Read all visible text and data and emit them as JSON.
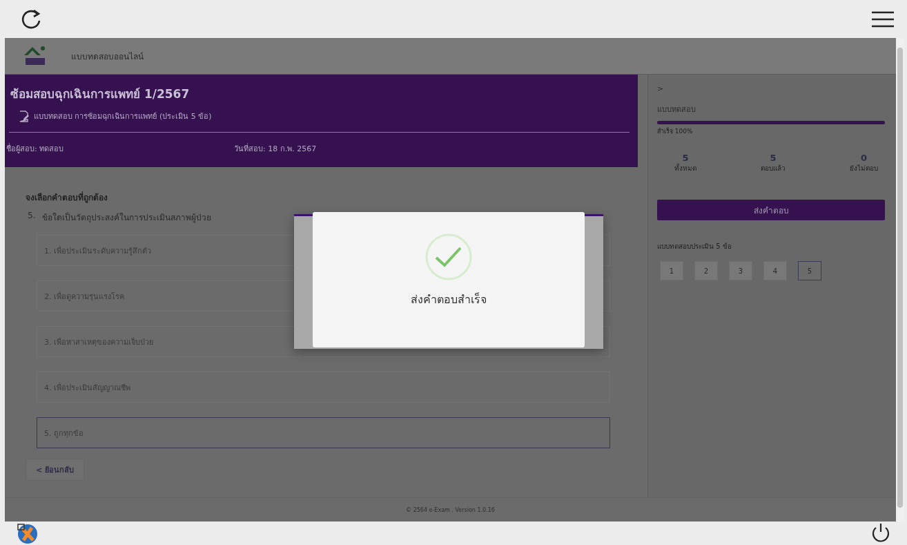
{
  "app_header": {
    "title": "แบบทดสอบออนไลน์"
  },
  "exam_header": {
    "title": "ซ้อมสอบฉุกเฉินการแพทย์ 1/2567",
    "subtitle": "แบบทดสอบ การซ้อมฉุกเฉินการแพทย์ (ประเมิน 5 ข้อ)",
    "examinee": "ชื่อผู้สอบ: ทดสอบ",
    "date": "วันที่สอบ: 18 ก.พ. 2567"
  },
  "question": {
    "instruction": "จงเลือกคำตอบที่ถูกต้อง",
    "number": "5.",
    "text": "ข้อใดเป็นวัตถุประสงค์ในการประเมินสภาพผู้ป่วย",
    "options": [
      {
        "label": "1. เพื่อประเมินระดับความรู้สึกตัว",
        "selected": false
      },
      {
        "label": "2. เพื่อดูความรุนแรงโรค",
        "selected": false
      },
      {
        "label": "3. เพื่อหาสาเหตุของความเจ็บป่วย",
        "selected": false
      },
      {
        "label": "4. เพื่อประเมินสัญญาณชีพ",
        "selected": false
      },
      {
        "label": "5. ถูกทุกข้อ",
        "selected": true
      }
    ]
  },
  "back_button": "< ย้อนกลับ",
  "sidebar": {
    "toggle": ">",
    "progress_title": "แบบทดสอบ",
    "level": 1,
    "progress_text": "สำเร็จ 100%",
    "stats": [
      {
        "value": "5",
        "label": "ทั้งหมด"
      },
      {
        "value": "5",
        "label": "ตอบแล้ว"
      },
      {
        "value": "0",
        "label": "ยังไม่ตอบ"
      }
    ],
    "submit_button": "ส่งคำตอบ",
    "nav_title": "แบบทดสอบประเมิน 5 ข้อ",
    "nav": [
      {
        "label": "1",
        "selected": false
      },
      {
        "label": "2",
        "selected": false
      },
      {
        "label": "3",
        "selected": false
      },
      {
        "label": "4",
        "selected": false
      },
      {
        "label": "5",
        "selected": true
      }
    ]
  },
  "footer": "© 2564 e-Exam . Version 1.0.16",
  "dialog": {
    "message": "ส่งคำตอบสำเร็จ"
  }
}
